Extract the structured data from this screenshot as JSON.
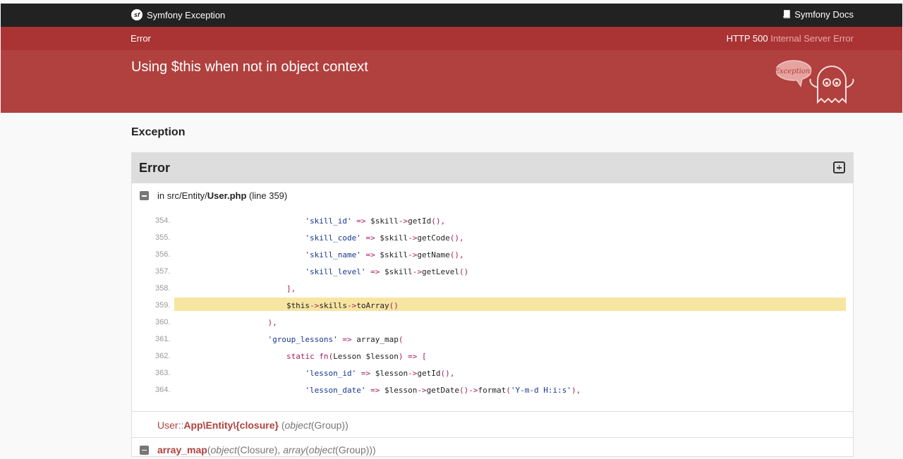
{
  "topbar": {
    "brand": "Symfony Exception",
    "docs_link": "Symfony Docs",
    "icons": {
      "brand": "symfony-logo-icon",
      "docs": "book-icon"
    }
  },
  "status": {
    "label": "Error",
    "code_prefix": "HTTP 500",
    "code_text": "Internal Server Error"
  },
  "header": {
    "message": "Using $this when not in object context",
    "illustration_text": "Exception!"
  },
  "section": {
    "title": "Exception"
  },
  "panel": {
    "title": "Error",
    "file": {
      "prefix": "in src/Entity/",
      "name": "User.php",
      "line_info": "(line 359)"
    },
    "code_lines": [
      {
        "num": "354.",
        "text": "                            'skill_id' => $skill->getId(),",
        "selected": false
      },
      {
        "num": "355.",
        "text": "                            'skill_code' => $skill->getCode(),",
        "selected": false
      },
      {
        "num": "356.",
        "text": "                            'skill_name' => $skill->getName(),",
        "selected": false
      },
      {
        "num": "357.",
        "text": "                            'skill_level' => $skill->getLevel()",
        "selected": false
      },
      {
        "num": "358.",
        "text": "                        ],",
        "selected": false
      },
      {
        "num": "359.",
        "text": "                        $this->skills->toArray()",
        "selected": true
      },
      {
        "num": "360.",
        "text": "                    ),",
        "selected": false
      },
      {
        "num": "361.",
        "text": "                    'group_lessons' => array_map(",
        "selected": false
      },
      {
        "num": "362.",
        "text": "                        static fn(Lesson $lesson) => [",
        "selected": false
      },
      {
        "num": "363.",
        "text": "                            'lesson_id' => $lesson->getId(),",
        "selected": false
      },
      {
        "num": "364.",
        "text": "                            'lesson_date' => $lesson->getDate()->format('Y-m-d H:i:s'),",
        "selected": false
      }
    ],
    "trace": {
      "class": "User",
      "sep": "::",
      "function": "App\\Entity\\{closure}",
      "args": "(object(Group))"
    },
    "trace_next": {
      "function": "array_map",
      "args": "(object(Closure), array(object(Group)))"
    }
  },
  "colors": {
    "topbar": "#222222",
    "status_bar": "#aa3333",
    "header": "#b0413e",
    "highlight": "#f7e5a2"
  }
}
